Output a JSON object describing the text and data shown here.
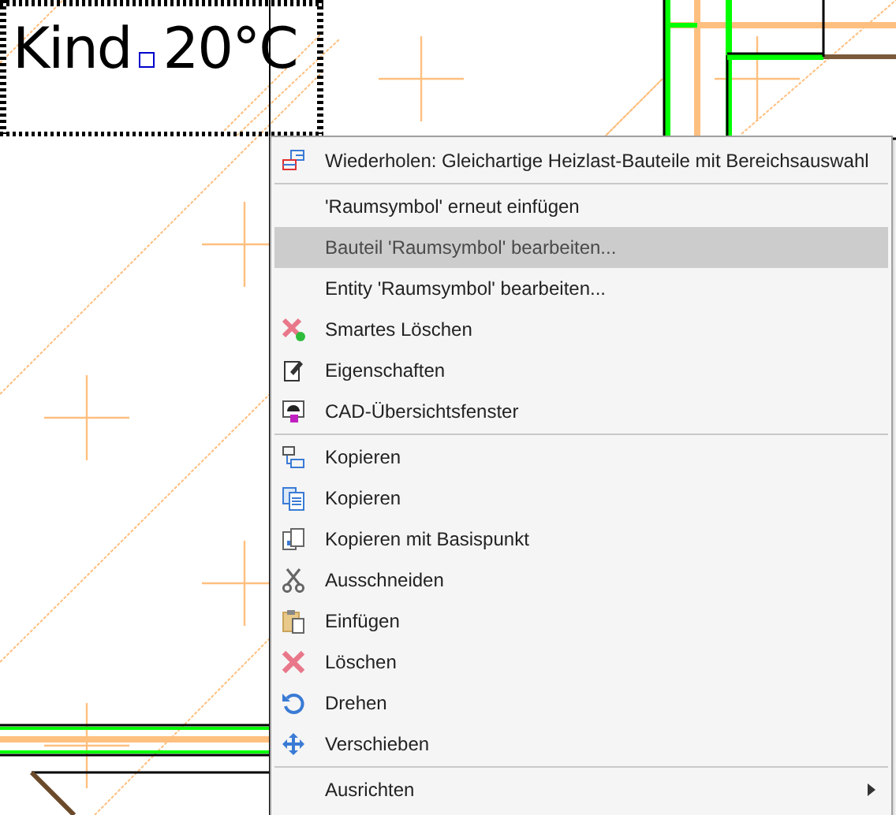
{
  "drawing": {
    "room_name": "Kind",
    "temperature": "20°C"
  },
  "context_menu": {
    "items": [
      {
        "kind": "item",
        "label": "Wiederholen: Gleichartige Heizlast-Bauteile mit Bereichsauswahl",
        "selected": false,
        "submenu": false
      },
      {
        "kind": "separator"
      },
      {
        "kind": "item",
        "label": "'Raumsymbol' erneut einfügen",
        "selected": false,
        "submenu": false
      },
      {
        "kind": "item",
        "label": "Bauteil 'Raumsymbol' bearbeiten...",
        "selected": true,
        "submenu": false
      },
      {
        "kind": "item",
        "label": "Entity 'Raumsymbol' bearbeiten...",
        "selected": false,
        "submenu": false
      },
      {
        "kind": "item",
        "label": "Smartes Löschen",
        "selected": false,
        "submenu": false
      },
      {
        "kind": "item",
        "label": "Eigenschaften",
        "selected": false,
        "submenu": false
      },
      {
        "kind": "item",
        "label": "CAD-Übersichtsfenster",
        "selected": false,
        "submenu": false
      },
      {
        "kind": "separator"
      },
      {
        "kind": "item",
        "label": "Kopieren",
        "selected": false,
        "submenu": false
      },
      {
        "kind": "item",
        "label": "Kopieren",
        "selected": false,
        "submenu": false
      },
      {
        "kind": "item",
        "label": "Kopieren mit Basispunkt",
        "selected": false,
        "submenu": false
      },
      {
        "kind": "item",
        "label": "Ausschneiden",
        "selected": false,
        "submenu": false
      },
      {
        "kind": "item",
        "label": "Einfügen",
        "selected": false,
        "submenu": false
      },
      {
        "kind": "item",
        "label": "Löschen",
        "selected": false,
        "submenu": false
      },
      {
        "kind": "item",
        "label": "Drehen",
        "selected": false,
        "submenu": false
      },
      {
        "kind": "item",
        "label": "Verschieben",
        "selected": false,
        "submenu": false
      },
      {
        "kind": "separator"
      },
      {
        "kind": "item",
        "label": "Ausrichten",
        "selected": false,
        "submenu": true
      }
    ]
  }
}
